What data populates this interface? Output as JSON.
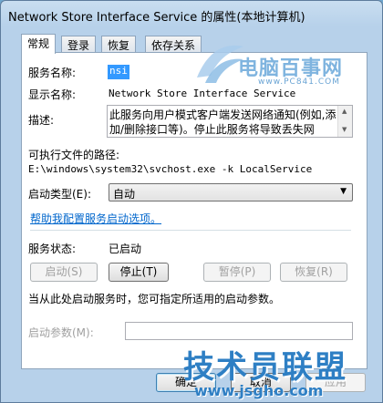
{
  "window": {
    "title": "Network Store Interface Service 的属性(本地计算机)"
  },
  "tabs": [
    {
      "label": "常规"
    },
    {
      "label": "登录"
    },
    {
      "label": "恢复"
    },
    {
      "label": "依存关系"
    }
  ],
  "general": {
    "service_name_label": "服务名称:",
    "service_name_value": "nsi",
    "display_name_label": "显示名称:",
    "display_name_value": "Network Store Interface Service",
    "description_label": "描述:",
    "description_value": "此服务向用户模式客户端发送网络通知(例如,添加/删除接口等)。停止此服务将导致丢失网",
    "exe_path_label": "可执行文件的路径:",
    "exe_path_value": "E:\\windows\\system32\\svchost.exe -k LocalService",
    "startup_type_label": "启动类型(E):",
    "startup_type_value": "自动",
    "help_link": "帮助我配置服务启动选项。",
    "service_status_label": "服务状态:",
    "service_status_value": "已启动",
    "buttons": {
      "start": "启动(S)",
      "stop": "停止(T)",
      "pause": "暂停(P)",
      "resume": "恢复(R)"
    },
    "hint": "当从此处启动服务时，您可指定所适用的启动参数。",
    "start_params_label": "启动参数(M):",
    "start_params_value": ""
  },
  "footer": {
    "ok": "确定",
    "cancel": "取消",
    "apply": "应用"
  },
  "watermarks": {
    "top_logo": "电脑百事网",
    "top_sub": "www.PC841.COM",
    "bottom_logo": "技术员联盟",
    "bottom_url": "www.jsgho.com"
  }
}
